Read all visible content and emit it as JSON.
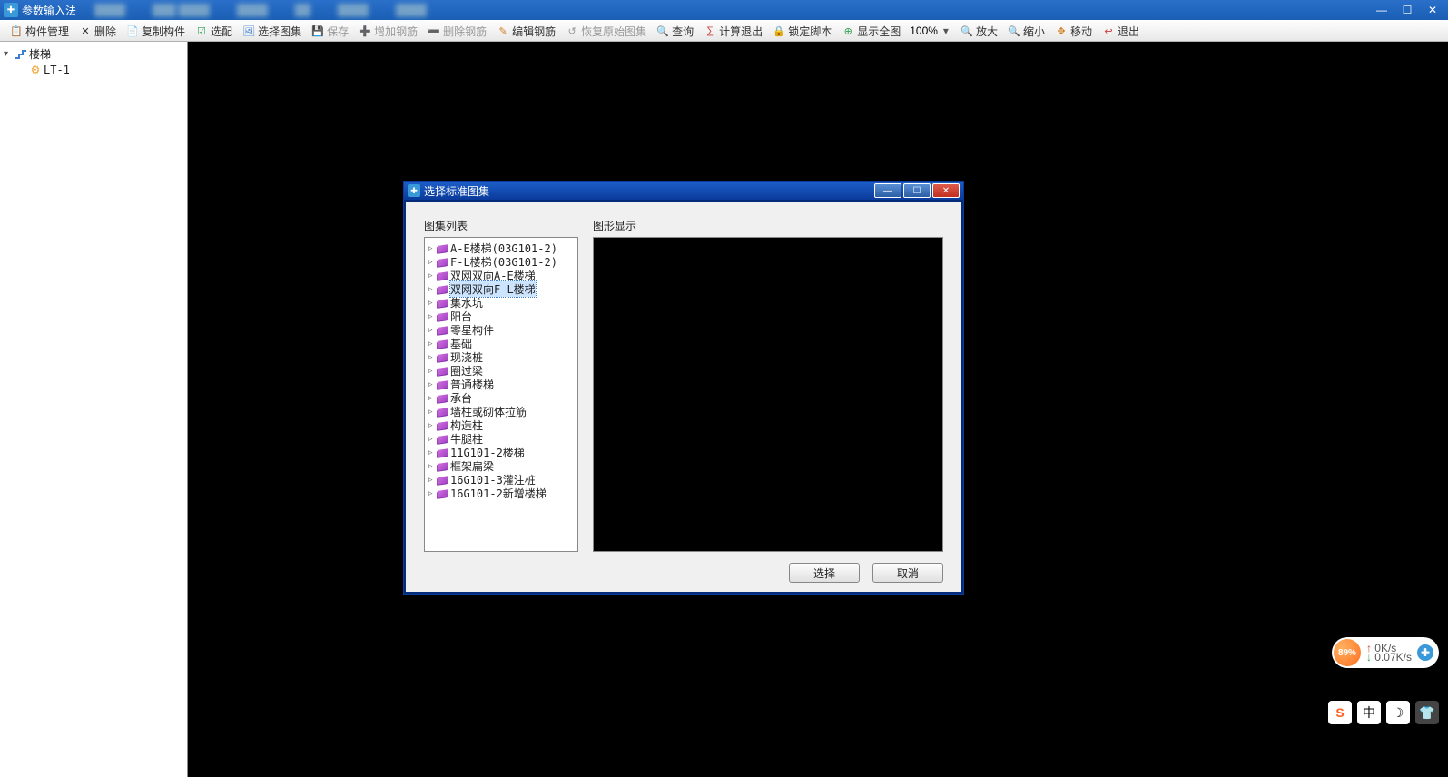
{
  "window": {
    "title": "参数输入法"
  },
  "win_controls": {
    "min": "—",
    "max": "☐",
    "close": "✕"
  },
  "toolbar": {
    "items": [
      {
        "icon": "📋",
        "label": "构件管理",
        "color": "#3a7fd5"
      },
      {
        "icon": "✕",
        "label": "删除",
        "color": "#333"
      },
      {
        "icon": "📄",
        "label": "复制构件",
        "color": "#3a7fd5"
      },
      {
        "icon": "☑",
        "label": "选配",
        "color": "#30a050"
      },
      {
        "icon": "🖼",
        "label": "选择图集",
        "color": "#3a7fd5"
      },
      {
        "icon": "💾",
        "label": "保存",
        "color": "#999",
        "disabled": true
      },
      {
        "icon": "➕",
        "label": "增加钢筋",
        "color": "#999",
        "disabled": true
      },
      {
        "icon": "➖",
        "label": "删除钢筋",
        "color": "#999",
        "disabled": true
      },
      {
        "icon": "✎",
        "label": "编辑钢筋",
        "color": "#d08020"
      },
      {
        "icon": "↺",
        "label": "恢复原始图集",
        "color": "#999",
        "disabled": true
      },
      {
        "icon": "🔍",
        "label": "查询",
        "color": "#3a7fd5"
      },
      {
        "icon": "∑",
        "label": "计算退出",
        "color": "#d04040"
      },
      {
        "icon": "🔒",
        "label": "锁定脚本",
        "color": "#d08020"
      },
      {
        "icon": "⊕",
        "label": "显示全图",
        "color": "#30a050"
      }
    ],
    "zoom_value": "100%",
    "zoom_items": [
      {
        "icon": "🔍",
        "label": "放大"
      },
      {
        "icon": "🔍",
        "label": "缩小"
      },
      {
        "icon": "✥",
        "label": "移动",
        "color": "#d08020"
      },
      {
        "icon": "↩",
        "label": "退出",
        "color": "#d04040"
      }
    ]
  },
  "sidebar": {
    "root": {
      "label": "楼梯"
    },
    "child": {
      "label": "LT-1"
    }
  },
  "dialog": {
    "title": "选择标准图集",
    "left_label": "图集列表",
    "right_label": "图形显示",
    "items": [
      "A-E楼梯(03G101-2)",
      "F-L楼梯(03G101-2)",
      "双网双向A-E楼梯",
      "双网双向F-L楼梯",
      "集水坑",
      "阳台",
      "零星构件",
      "基础",
      "现浇桩",
      "圈过梁",
      "普通楼梯",
      "承台",
      "墙柱或砌体拉筋",
      "构造柱",
      "牛腿柱",
      "11G101-2楼梯",
      "框架扁梁",
      "16G101-3灌注桩",
      "16G101-2新增楼梯"
    ],
    "selected_index": 3,
    "ok": "选择",
    "cancel": "取消"
  },
  "float": {
    "percent": "89%",
    "up": "0K/s",
    "down": "0.07K/s",
    "tray": [
      "S",
      "中",
      "☽",
      "👕"
    ]
  }
}
